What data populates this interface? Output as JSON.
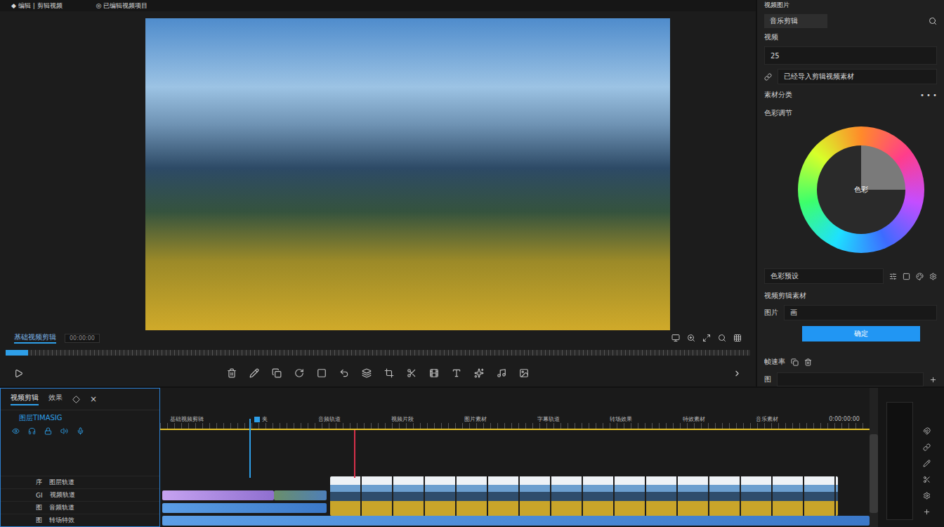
{
  "topbar": {
    "left": "◆ 编辑 | 剪辑视频",
    "center": "◎ 已编辑视频项目"
  },
  "viewer": {
    "title": "基础视频剪辑",
    "timecode": "00:00:00",
    "progress": 0.03
  },
  "inspector": {
    "title": "视频图片",
    "search": "音乐剪辑",
    "field_label": "视频",
    "field_value": "25",
    "import_row": "已经导入剪辑视频素材",
    "category": "素材分类",
    "more": "• • •",
    "color_title": "色彩调节",
    "wheel_label": "色彩",
    "preset": "色彩预设",
    "media_title": "视频剪辑素材",
    "image_label": "图片",
    "image_value": "画",
    "apply_button": "确定",
    "fps_label": "帧速率",
    "footer_label": "图"
  },
  "layers": {
    "tabs": [
      {
        "label": "视频剪辑",
        "selected": true
      },
      {
        "label": "效果",
        "selected": false
      }
    ],
    "close": "×",
    "subtitle": "图层TIMASIG",
    "tracks": [
      {
        "code": "序",
        "label": "图层轨道"
      },
      {
        "code": "GI",
        "label": "视频轨道"
      },
      {
        "code": "图",
        "label": "音频轨道"
      },
      {
        "code": "图",
        "label": "转场特效"
      }
    ]
  },
  "timeline": {
    "duration": 100,
    "ruler": [
      {
        "label": "基础视频剪辑",
        "marker": false
      },
      {
        "label": "夹",
        "marker": true
      },
      {
        "label": "音频轨道",
        "marker": false
      },
      {
        "label": "视频片段",
        "marker": false
      },
      {
        "label": "图片素材",
        "marker": false
      },
      {
        "label": "字幕轨道",
        "marker": false
      },
      {
        "label": "转场效果",
        "marker": false
      },
      {
        "label": "特效素材",
        "marker": false
      },
      {
        "label": "音乐素材",
        "marker": false
      },
      {
        "label": "0:00:00:00",
        "marker": false
      }
    ],
    "marker": 0.126,
    "playhead": 0.273,
    "clips": [
      {
        "kind": "thumbs",
        "track": 0,
        "start": 24,
        "end": 95.5
      },
      {
        "kind": "purple",
        "track": 1,
        "start": 0.3,
        "end": 16
      },
      {
        "kind": "green",
        "track": 1,
        "start": 16,
        "end": 23.5
      },
      {
        "kind": "blue",
        "track": 2,
        "start": 0.3,
        "end": 23.5
      },
      {
        "kind": "blue",
        "track": 3,
        "start": 0.3,
        "end": 100
      }
    ]
  }
}
